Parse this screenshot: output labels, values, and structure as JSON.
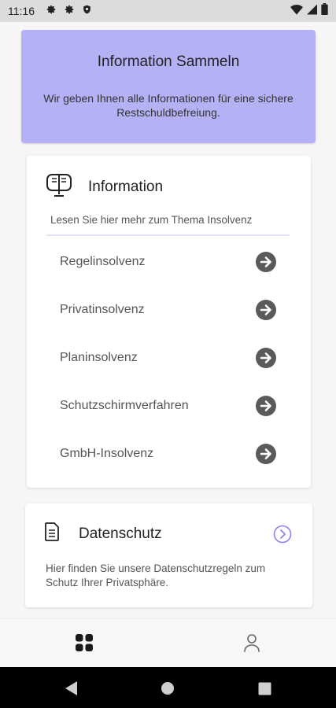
{
  "status_bar": {
    "time": "11:16",
    "icons": [
      "gear-icon",
      "gear-icon",
      "shield-icon",
      "wifi-icon",
      "signal-icon",
      "battery-icon"
    ]
  },
  "header": {
    "title": "Information Sammeln",
    "subtitle": "Wir geben Ihnen alle Informationen für eine sichere Restschuldbefreiung.",
    "background": "#b4b1f5"
  },
  "information": {
    "title": "Information",
    "lead": "Lesen Sie hier mehr zum Thema Insolvenz",
    "items": [
      {
        "label": "Regelinsolvenz"
      },
      {
        "label": "Privatinsolvenz"
      },
      {
        "label": "Planinsolvenz"
      },
      {
        "label": "Schutzschirmverfahren"
      },
      {
        "label": "GmbH-Insolvenz"
      }
    ],
    "arrow_color": "#5a5a5a",
    "divider_color": "#e4e1fb"
  },
  "privacy": {
    "title": "Datenschutz",
    "description": "Hier finden Sie unsere Datenschutzregeln zum Schutz Ihrer Privatsphäre.",
    "accent": "#8b82f0"
  },
  "bottom_nav": {
    "items": [
      {
        "icon": "dashboard-icon",
        "active": true
      },
      {
        "icon": "profile-icon",
        "active": false
      }
    ]
  },
  "system_nav": [
    "back-icon",
    "home-icon",
    "recents-icon"
  ]
}
